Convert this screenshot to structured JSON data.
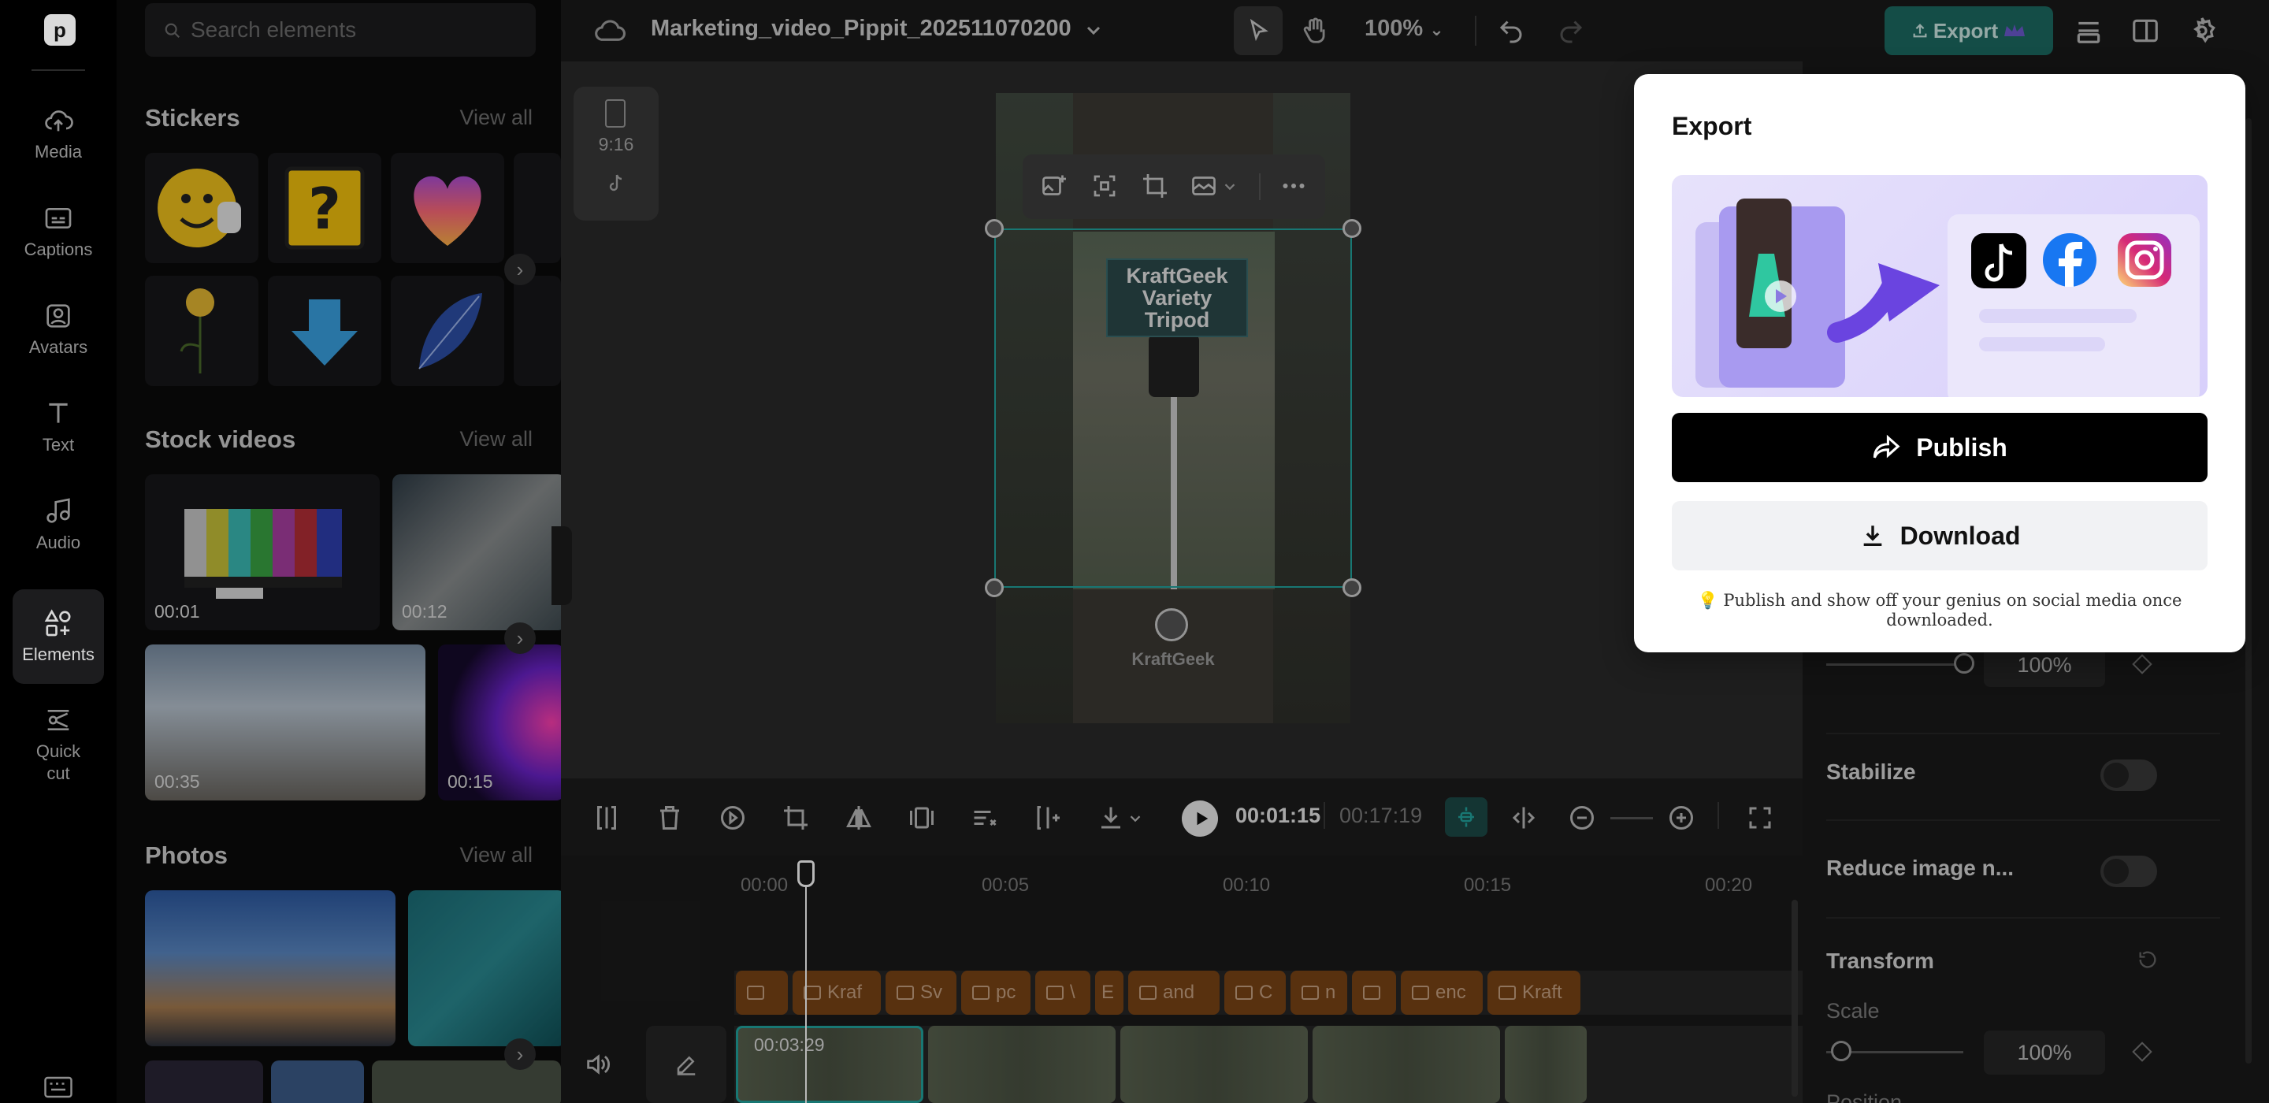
{
  "nav": {
    "items": [
      {
        "label": "Media",
        "icon": "cloud-upload-icon"
      },
      {
        "label": "Captions",
        "icon": "captions-icon"
      },
      {
        "label": "Avatars",
        "icon": "avatar-icon"
      },
      {
        "label": "Text",
        "icon": "text-icon"
      },
      {
        "label": "Audio",
        "icon": "music-note-icon"
      },
      {
        "label": "Elements",
        "icon": "elements-icon",
        "active": true
      },
      {
        "label": "Quick cut",
        "icon": "quick-cut-icon"
      }
    ]
  },
  "panel": {
    "search_placeholder": "Search elements",
    "stickers": {
      "title": "Stickers",
      "view_all": "View all"
    },
    "stock_videos": {
      "title": "Stock videos",
      "view_all": "View all",
      "durations": [
        "00:01",
        "00:12",
        "00:35",
        "00:15"
      ]
    },
    "photos": {
      "title": "Photos",
      "view_all": "View all"
    }
  },
  "topbar": {
    "project_title": "Marketing_video_Pippit_202511070200",
    "zoom": "100%",
    "export_label": "Export"
  },
  "canvas": {
    "aspect_ratio": "9:16",
    "video_caption_line1": "KraftGeek",
    "video_caption_line2": "Variety Tripod",
    "watermark": "KraftGeek"
  },
  "timeline": {
    "current_time": "00:01:15",
    "total_time": "00:17:19",
    "ruler": [
      "00:00",
      "00:05",
      "00:10",
      "00:15",
      "00:20"
    ],
    "text_clips": [
      "Kraf",
      "Sv",
      "pc",
      "\\",
      "E",
      "and",
      "C",
      "n",
      "",
      "enc",
      "Kraft"
    ],
    "selected_clip_time": "00:03:29"
  },
  "properties": {
    "opacity_value": "100%",
    "stabilize_label": "Stabilize",
    "reduce_noise_label": "Reduce image n...",
    "transform_label": "Transform",
    "scale_label": "Scale",
    "scale_value": "100%",
    "position_label": "Position"
  },
  "export_modal": {
    "title": "Export",
    "publish_label": "Publish",
    "download_label": "Download",
    "note": "💡 Publish and show off your genius on social media once downloaded."
  },
  "colors": {
    "accent_teal": "#22a6a0",
    "export_button": "#1d6b63",
    "text_clip": "#7a4416",
    "tiktok": "#000000",
    "facebook": "#1877f2",
    "instagram_gradient_start": "#feda75",
    "instagram_gradient_end": "#962fbf"
  }
}
